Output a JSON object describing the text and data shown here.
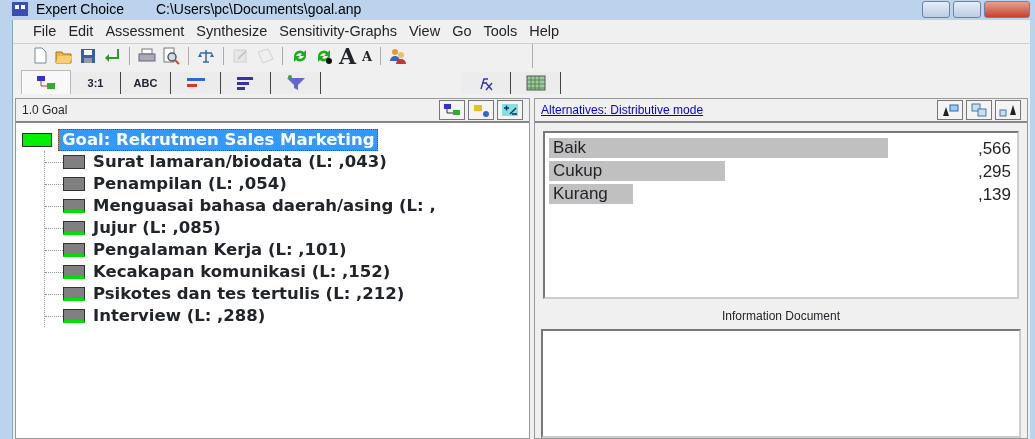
{
  "window": {
    "app": "Expert Choice",
    "path": "C:\\Users\\pc\\Documents\\goal.anp"
  },
  "menu": [
    {
      "label": "File"
    },
    {
      "label": "Edit"
    },
    {
      "label": "Assessment"
    },
    {
      "label": "Synthesize"
    },
    {
      "label": "Sensitivity-Graphs"
    },
    {
      "label": "View"
    },
    {
      "label": "Go"
    },
    {
      "label": "Tools"
    },
    {
      "label": "Help"
    }
  ],
  "toolbar": [
    {
      "kind": "new",
      "disabled": false
    },
    {
      "kind": "open",
      "disabled": false
    },
    {
      "kind": "save",
      "disabled": false
    },
    {
      "kind": "enter",
      "disabled": false
    },
    {
      "kind": "sep"
    },
    {
      "kind": "print",
      "disabled": false
    },
    {
      "kind": "preview",
      "disabled": false
    },
    {
      "kind": "sep"
    },
    {
      "kind": "balance",
      "disabled": false
    },
    {
      "kind": "sep"
    },
    {
      "kind": "pencil",
      "disabled": true
    },
    {
      "kind": "sheet",
      "disabled": true
    },
    {
      "kind": "sep"
    },
    {
      "kind": "recycle",
      "disabled": false
    },
    {
      "kind": "recycle2",
      "disabled": false
    },
    {
      "kind": "glyph",
      "label": "A",
      "disabled": false
    },
    {
      "kind": "glyph-small",
      "label": "A",
      "disabled": false
    },
    {
      "kind": "sep"
    },
    {
      "kind": "people",
      "disabled": false
    }
  ],
  "tabs": [
    {
      "kind": "tree",
      "selected": true
    },
    {
      "kind": "text",
      "label": "3:1",
      "selected": false
    },
    {
      "kind": "text",
      "label": "ABC",
      "selected": false
    },
    {
      "kind": "bars-red",
      "selected": false
    },
    {
      "kind": "bars-blue",
      "selected": false
    },
    {
      "kind": "funnel",
      "selected": false
    },
    {
      "kind": "gap"
    },
    {
      "kind": "fx",
      "selected": false
    },
    {
      "kind": "grid",
      "selected": false
    }
  ],
  "left_pane": {
    "title": "1.0 Goal",
    "tree": {
      "label": "Goal: Rekrutmen Sales Marketing",
      "selected": true,
      "children": [
        {
          "label": "Surat lamaran/biodata (L: ,043)",
          "judged": false
        },
        {
          "label": "Penampilan (L: ,054)",
          "judged": false
        },
        {
          "label": "Menguasai bahasa daerah/asing (L: ,",
          "judged": true
        },
        {
          "label": "Jujur (L: ,085)",
          "judged": true
        },
        {
          "label": "Pengalaman Kerja (L: ,101)",
          "judged": true
        },
        {
          "label": "Kecakapan komunikasi (L: ,152)",
          "judged": true
        },
        {
          "label": "Psikotes dan tes tertulis (L: ,212)",
          "judged": true
        },
        {
          "label": "Interview (L: ,288)",
          "judged": true
        }
      ]
    }
  },
  "right_pane": {
    "link": "Alternatives: Distributive mode",
    "alternatives": [
      {
        "name": "Baik",
        "level": 0.73,
        "value": ",566"
      },
      {
        "name": "Cukup",
        "level": 0.38,
        "value": ",295"
      },
      {
        "name": "Kurang",
        "level": 0.18,
        "value": ",139"
      }
    ],
    "info_title": "Information Document"
  }
}
